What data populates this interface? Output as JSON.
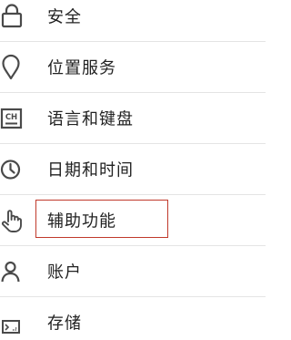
{
  "settings": {
    "items": [
      {
        "label": "安全",
        "icon": "lock-icon"
      },
      {
        "label": "位置服务",
        "icon": "location-pin-icon"
      },
      {
        "label": "语言和键盘",
        "icon": "keyboard-ch-icon"
      },
      {
        "label": "日期和时间",
        "icon": "clock-icon"
      },
      {
        "label": "辅助功能",
        "icon": "hand-pointer-icon"
      },
      {
        "label": "账户",
        "icon": "person-icon"
      },
      {
        "label": "存储",
        "icon": "storage-card-icon"
      }
    ]
  },
  "ch_icon_text": "CH",
  "colors": {
    "icon": "#4a4a4a",
    "text": "#222222",
    "divider": "#e4e4e4",
    "highlight": "#c0392b"
  }
}
